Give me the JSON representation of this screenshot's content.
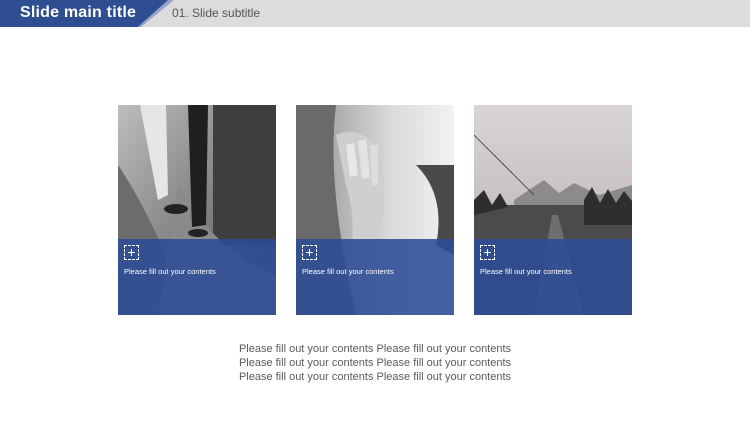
{
  "header": {
    "title": "Slide main title",
    "subtitle": "01. Slide subtitle"
  },
  "cards": [
    {
      "icon": "plus-icon",
      "text": "Please fill out your contents"
    },
    {
      "icon": "plus-icon",
      "text": "Please fill out your contents"
    },
    {
      "icon": "plus-icon",
      "text": "Please fill out your contents"
    }
  ],
  "body": {
    "lines": [
      "Please fill out your contents Please fill out your contents",
      "Please fill out your contents Please fill out your contents",
      "Please fill out your contents Please fill out your contents"
    ]
  },
  "colors": {
    "accent": "#2f4e92",
    "header_bg": "#dcdcdc"
  }
}
